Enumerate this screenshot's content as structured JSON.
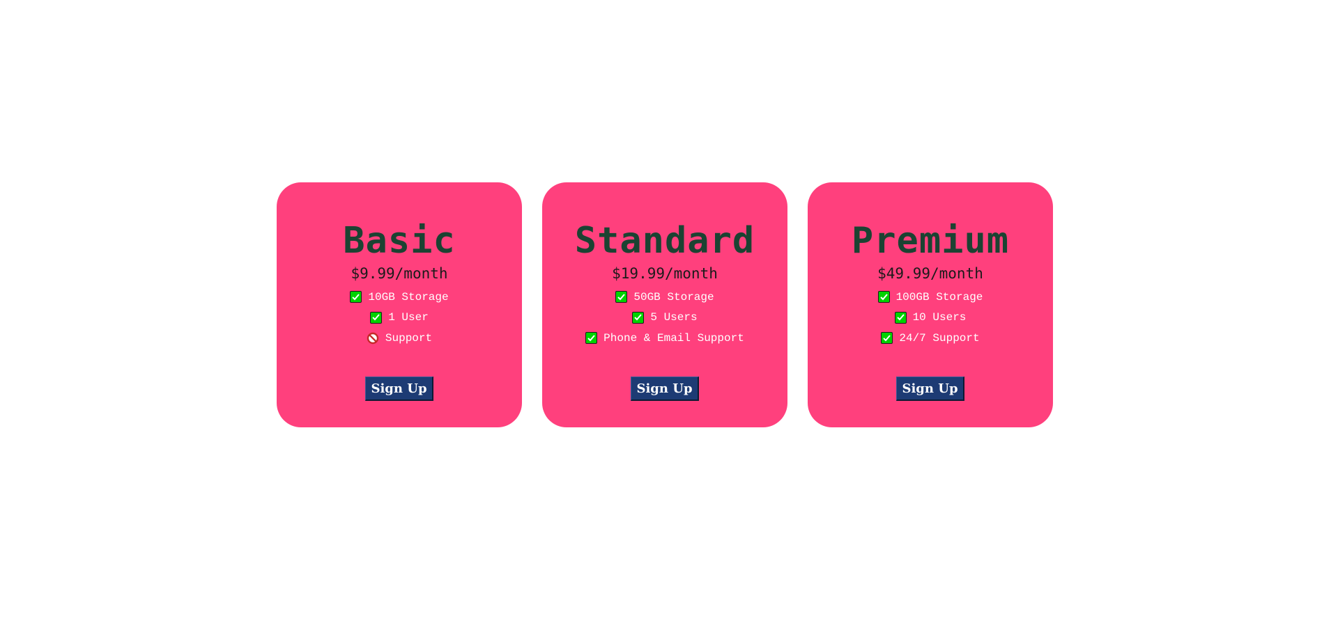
{
  "plans": [
    {
      "name": "Basic",
      "price": "$9.99/month",
      "features": [
        {
          "icon": "check-icon",
          "text": "10GB Storage"
        },
        {
          "icon": "check-icon",
          "text": "1 User"
        },
        {
          "icon": "prohibited-icon",
          "text": "Support"
        }
      ],
      "button_label": "Sign Up"
    },
    {
      "name": "Standard",
      "price": "$19.99/month",
      "features": [
        {
          "icon": "check-icon",
          "text": "50GB Storage"
        },
        {
          "icon": "check-icon",
          "text": "5 Users"
        },
        {
          "icon": "check-icon",
          "text": "Phone & Email Support"
        }
      ],
      "button_label": "Sign Up"
    },
    {
      "name": "Premium",
      "price": "$49.99/month",
      "features": [
        {
          "icon": "check-icon",
          "text": "100GB Storage"
        },
        {
          "icon": "check-icon",
          "text": "10 Users"
        },
        {
          "icon": "check-icon",
          "text": "24/7 Support"
        }
      ],
      "button_label": "Sign Up"
    }
  ],
  "colors": {
    "card_background": "#ff407d",
    "plan_name": "#1b4332",
    "button_background": "#1d3b74",
    "check_green": "#00d300"
  }
}
